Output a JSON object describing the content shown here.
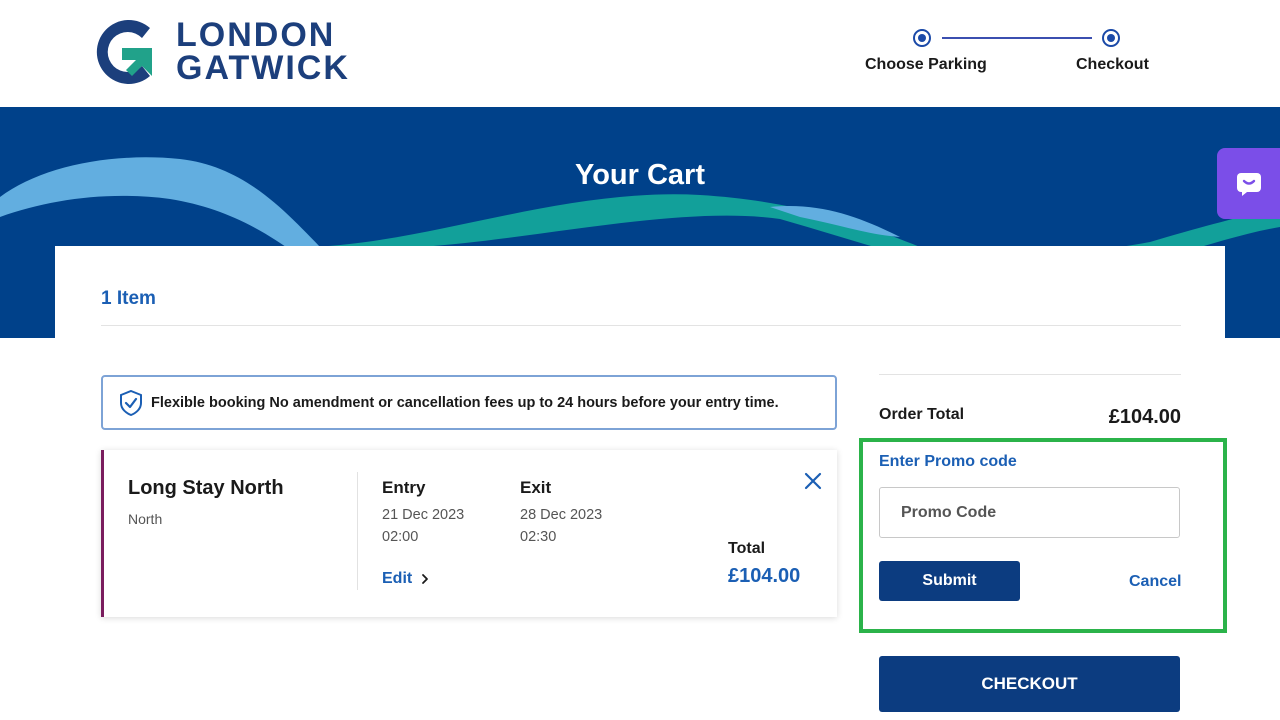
{
  "brand": {
    "line1": "LONDON",
    "line2": "GATWICK"
  },
  "steps": [
    {
      "label": "Choose Parking"
    },
    {
      "label": "Checkout"
    }
  ],
  "hero": {
    "title": "Your Cart"
  },
  "cart": {
    "item_count": "1 Item",
    "banner": "Flexible booking No amendment or cancellation fees up to 24 hours before your entry time.",
    "booking": {
      "name": "Long Stay North",
      "location": "North",
      "entry_label": "Entry",
      "entry_date": "21 Dec 2023",
      "entry_time": "02:00",
      "exit_label": "Exit",
      "exit_date": "28 Dec 2023",
      "exit_time": "02:30",
      "edit_label": "Edit",
      "total_label": "Total",
      "total_value": "£104.00"
    }
  },
  "summary": {
    "order_total_label": "Order Total",
    "order_total_value": "£104.00",
    "promo_title": "Enter Promo code",
    "promo_placeholder": "Promo Code",
    "submit_label": "Submit",
    "cancel_label": "Cancel",
    "checkout_label": "CHECKOUT"
  },
  "icons": {
    "logo": "gatwick-logo-icon",
    "shield": "shield-check-icon",
    "close": "close-icon",
    "chevron": "chevron-right-icon",
    "chat": "chat-icon"
  },
  "colors": {
    "brand_navy": "#00418a",
    "link_blue": "#1b5fb4",
    "button_navy": "#0c3c80",
    "highlight_green": "#2bb34a",
    "chat_purple": "#7b4ee8",
    "booking_accent": "#7a1d5e"
  }
}
